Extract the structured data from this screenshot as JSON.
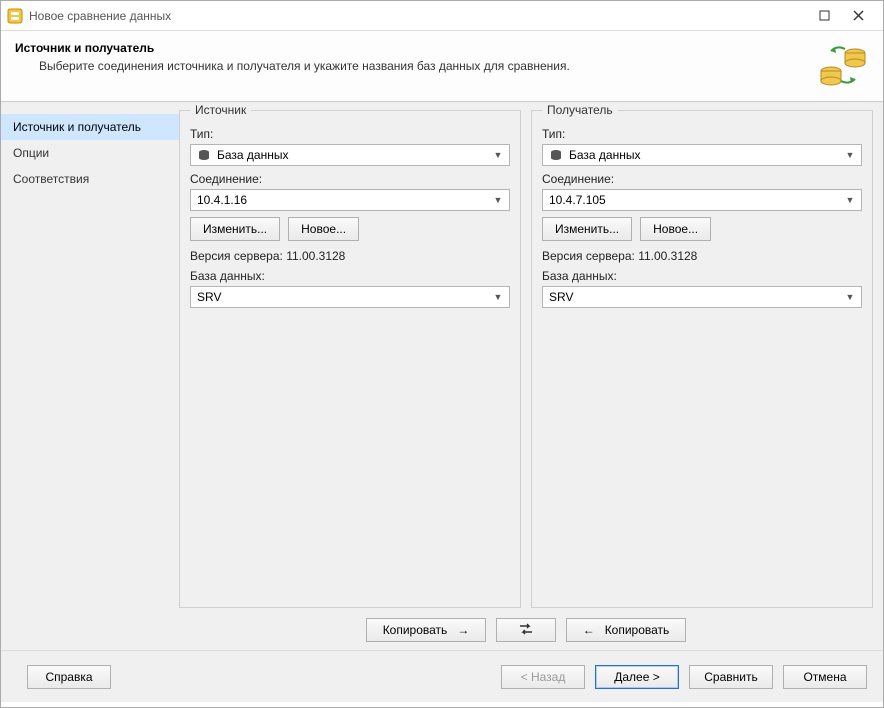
{
  "window": {
    "title": "Новое сравнение данных"
  },
  "header": {
    "title": "Источник и получатель",
    "subtitle": "Выберите соединения источника и получателя и укажите названия баз данных для сравнения."
  },
  "sidebar": {
    "items": [
      {
        "label": "Источник и получатель",
        "active": true
      },
      {
        "label": "Опции",
        "active": false
      },
      {
        "label": "Соответствия",
        "active": false
      }
    ]
  },
  "source": {
    "legend": "Источник",
    "type_label": "Тип:",
    "type_value": "База данных",
    "conn_label": "Соединение:",
    "conn_value": "10.4.1.16",
    "edit_btn": "Изменить...",
    "new_btn": "Новое...",
    "version_label": "Версия сервера:",
    "version_value": "11.00.3128",
    "db_label": "База данных:",
    "db_value": "SRV"
  },
  "target": {
    "legend": "Получатель",
    "type_label": "Тип:",
    "type_value": "База данных",
    "conn_label": "Соединение:",
    "conn_value": "10.4.7.105",
    "edit_btn": "Изменить...",
    "new_btn": "Новое...",
    "version_label": "Версия сервера:",
    "version_value": "11.00.3128",
    "db_label": "База данных:",
    "db_value": "SRV"
  },
  "copy": {
    "to_right": "Копировать",
    "to_left": "Копировать"
  },
  "footer": {
    "help": "Справка",
    "back": "< Назад",
    "next": "Далее >",
    "compare": "Сравнить",
    "cancel": "Отмена"
  }
}
